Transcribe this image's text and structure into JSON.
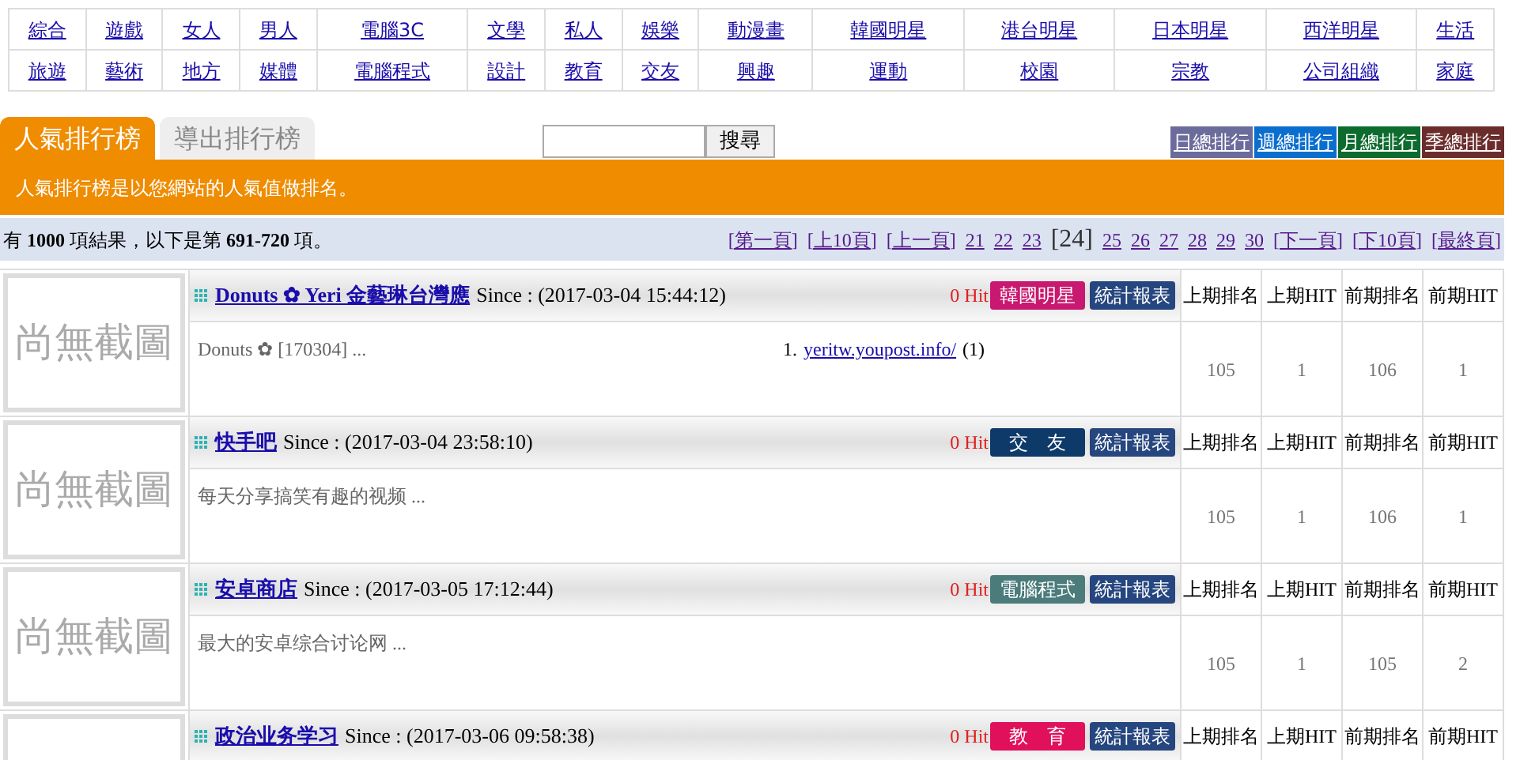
{
  "categories": [
    [
      "綜合",
      "遊戲",
      "女人",
      "男人",
      "電腦3C",
      "文學",
      "私人",
      "娛樂",
      "動漫畫",
      "韓國明星",
      "港台明星",
      "日本明星",
      "西洋明星",
      "生活"
    ],
    [
      "旅遊",
      "藝術",
      "地方",
      "媒體",
      "電腦程式",
      "設計",
      "教育",
      "交友",
      "興趣",
      "運動",
      "校園",
      "宗教",
      "公司組織",
      "家庭"
    ]
  ],
  "tabs": [
    {
      "label": "人氣排行榜",
      "selected": true
    },
    {
      "label": "導出排行榜",
      "selected": false
    }
  ],
  "search": {
    "button": "搜尋"
  },
  "rank_links": [
    {
      "label": "日總排行",
      "color": "#6b6b9c"
    },
    {
      "label": "週總排行",
      "color": "#0a6ecf"
    },
    {
      "label": "月總排行",
      "color": "#0d6b2e"
    },
    {
      "label": "季總排行",
      "color": "#6b2c2c"
    }
  ],
  "notice": "人氣排行榜是以您網站的人氣值做排名。",
  "result_summary": "有 **1000** 項結果，以下是第 **691-720** 項。",
  "pagination": [
    {
      "label": "[第一頁]",
      "selected": false
    },
    {
      "label": "[上10頁]",
      "selected": false
    },
    {
      "label": "[上一頁]",
      "selected": false
    },
    {
      "label": "21",
      "selected": false
    },
    {
      "label": "22",
      "selected": false
    },
    {
      "label": "23",
      "selected": false
    },
    {
      "label": "[24]",
      "selected": true
    },
    {
      "label": "25",
      "selected": false
    },
    {
      "label": "26",
      "selected": false
    },
    {
      "label": "27",
      "selected": false
    },
    {
      "label": "28",
      "selected": false
    },
    {
      "label": "29",
      "selected": false
    },
    {
      "label": "30",
      "selected": false
    },
    {
      "label": "[下一頁]",
      "selected": false
    },
    {
      "label": "[下10頁]",
      "selected": false
    },
    {
      "label": "[最終頁]",
      "selected": false
    }
  ],
  "entries": [
    {
      "thumbnail": "尚無截圖",
      "title": "Donuts ✿ Yeri 金藝琳台灣應",
      "since": "Since : (2017-03-04 15:44:12)",
      "hits": "0 Hit",
      "tag": {
        "label": "韓國明星",
        "color": "#c8186f"
      },
      "report": "統計報表",
      "description": "Donuts ✿ [170304] ...",
      "referrers": [
        {
          "index": "1.",
          "link": "yeritw.youpost.info/",
          "count": "(1)"
        }
      ],
      "stat_headers": [
        "上期排名",
        "上期HIT",
        "前期排名",
        "前期HIT"
      ],
      "stat_values": [
        "105",
        "1",
        "106",
        "1"
      ]
    },
    {
      "thumbnail": "尚無截圖",
      "title": "快手吧",
      "since": "Since : (2017-03-04 23:58:10)",
      "hits": "0 Hit",
      "tag": {
        "label": "交　友",
        "color": "#0e3a6a"
      },
      "report": "統計報表",
      "description": "每天分享搞笑有趣的视频 ...",
      "stat_headers": [
        "上期排名",
        "上期HIT",
        "前期排名",
        "前期HIT"
      ],
      "stat_values": [
        "105",
        "1",
        "106",
        "1"
      ]
    },
    {
      "thumbnail": "尚無截圖",
      "title": "安卓商店",
      "since": "Since : (2017-03-05 17:12:44)",
      "hits": "0 Hit",
      "tag": {
        "label": "電腦程式",
        "color": "#4b7b7b"
      },
      "report": "統計報表",
      "description": "最大的安卓综合讨论网 ...",
      "stat_headers": [
        "上期排名",
        "上期HIT",
        "前期排名",
        "前期HIT"
      ],
      "stat_values": [
        "105",
        "1",
        "105",
        "2"
      ]
    },
    {
      "title": "政治业务学习",
      "since": "Since : (2017-03-06 09:58:38)",
      "hits": "0 Hit",
      "tag": {
        "label": "教　育",
        "color": "#e0105a"
      },
      "report": "統計報表",
      "stat_headers": [
        "上期排名",
        "上期HIT",
        "前期排名",
        "前期HIT"
      ]
    }
  ]
}
